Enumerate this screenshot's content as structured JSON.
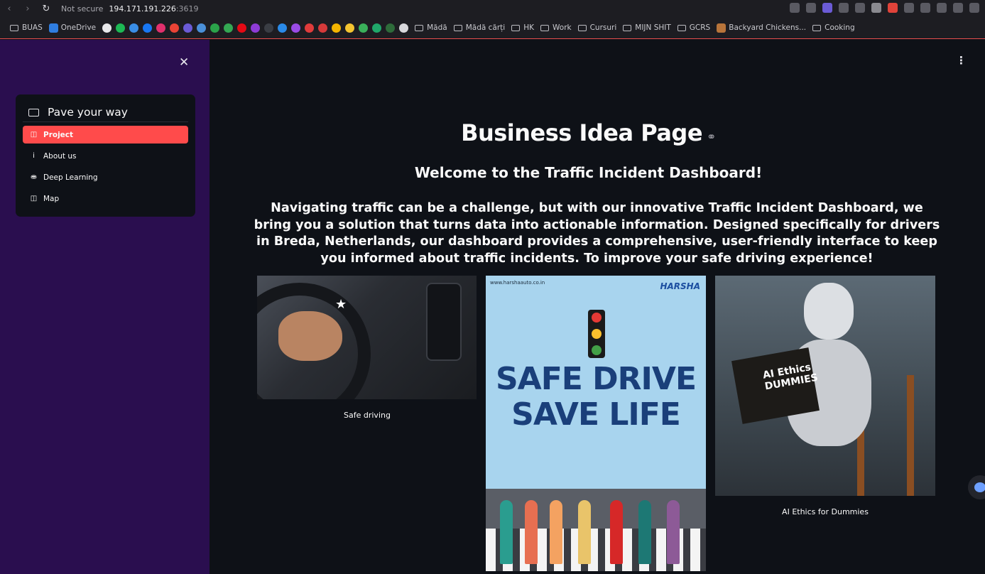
{
  "browser": {
    "security": "Not secure",
    "host": "194.171.191.226",
    "port": ":3619",
    "bookmarks": [
      "BUAS",
      "OneDrive",
      "Mădă",
      "Mădă cărți",
      "HK",
      "Work",
      "Cursuri",
      "MIJN SHIT",
      "GCRS",
      "Backyard Chickens...",
      "Cooking"
    ]
  },
  "sidebar": {
    "title": "Pave your way",
    "items": [
      {
        "label": "Project",
        "icon": "book-icon",
        "active": true
      },
      {
        "label": "About us",
        "icon": "info-icon",
        "active": false
      },
      {
        "label": "Deep Learning",
        "icon": "robot-icon",
        "active": false
      },
      {
        "label": "Map",
        "icon": "map-icon",
        "active": false
      }
    ]
  },
  "main": {
    "title": "Business Idea Page",
    "subtitle": "Welcome to the Traffic Incident Dashboard!",
    "paragraph": "Navigating traffic can be a challenge, but with our innovative Traffic Incident Dashboard, we bring you a solution that turns data into actionable information. Designed specifically for drivers in Breda, Netherlands, our dashboard provides a comprehensive, user-friendly interface to keep you informed about traffic incidents. To improve your safe driving experience!",
    "images": [
      {
        "caption": "Safe driving"
      },
      {
        "caption": "",
        "url": "www.harshaauto.co.in",
        "brand": "HARSHA",
        "line1": "SAFE DRIVE",
        "line2": "SAVE LIFE"
      },
      {
        "caption": "AI Ethics for Dummies",
        "book": "AI Ethics DUMMIES"
      }
    ]
  },
  "colors": {
    "accent": "#ff4b4b",
    "sidebar_bg": "#2a0e4f",
    "main_bg": "#0e1117"
  }
}
